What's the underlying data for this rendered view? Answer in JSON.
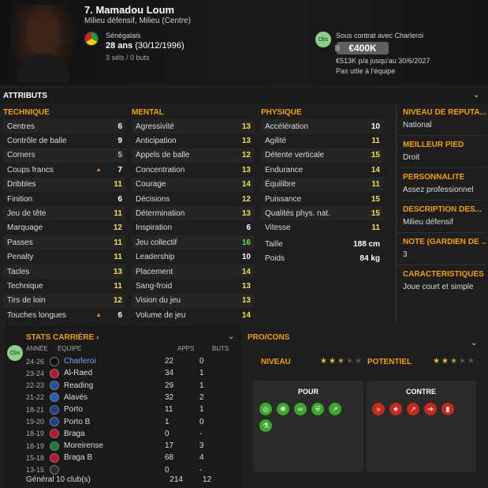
{
  "player": {
    "name": "7. Mamadou Loum",
    "role": "Milieu défensif, Milieu (Centre)",
    "nationality": "Sénégalais",
    "age": "28 ans",
    "dob": "(30/12/1996)",
    "caps": "3 séls / 0 buts",
    "obs_label": "Obs",
    "contract": "Sous contrat avec Charleroi",
    "value": "€400K",
    "wage": "€513K p/a jusqu'au 30/6/2027",
    "status": "Pas utile à l'équipe"
  },
  "attributes": {
    "title": "ATTRIBUTS",
    "technique_title": "TECHNIQUE",
    "mental_title": "MENTAL",
    "physique_title": "PHYSIQUE",
    "technique": [
      {
        "label": "Centres",
        "value": "6",
        "color": "#ffffff"
      },
      {
        "label": "Contrôle de balle",
        "value": "9",
        "color": "#ffffff"
      },
      {
        "label": "Corners",
        "value": "5",
        "color": "#bdbdbd"
      },
      {
        "label": "Coups francs",
        "value": "7",
        "color": "#ffffff",
        "arrow": true
      },
      {
        "label": "Dribbles",
        "value": "11",
        "color": "#f0e040"
      },
      {
        "label": "Finition",
        "value": "6",
        "color": "#ffffff"
      },
      {
        "label": "Jeu de tête",
        "value": "11",
        "color": "#f0e040"
      },
      {
        "label": "Marquage",
        "value": "12",
        "color": "#f0e040"
      },
      {
        "label": "Passes",
        "value": "11",
        "color": "#f0e040"
      },
      {
        "label": "Penalty",
        "value": "11",
        "color": "#f0e040"
      },
      {
        "label": "Tacles",
        "value": "13",
        "color": "#f0e040"
      },
      {
        "label": "Technique",
        "value": "11",
        "color": "#f0e040"
      },
      {
        "label": "Tirs de loin",
        "value": "12",
        "color": "#f0e040"
      },
      {
        "label": "Touches longues",
        "value": "6",
        "color": "#ffffff",
        "arrow": true
      }
    ],
    "mental": [
      {
        "label": "Agressivité",
        "value": "13",
        "color": "#f0e040"
      },
      {
        "label": "Anticipation",
        "value": "13",
        "color": "#f0e040"
      },
      {
        "label": "Appels de balle",
        "value": "12",
        "color": "#f0e040"
      },
      {
        "label": "Concentration",
        "value": "13",
        "color": "#f0e040"
      },
      {
        "label": "Courage",
        "value": "14",
        "color": "#f0e040"
      },
      {
        "label": "Décisions",
        "value": "12",
        "color": "#f0e040"
      },
      {
        "label": "Détermination",
        "value": "13",
        "color": "#f0e040"
      },
      {
        "label": "Inspiration",
        "value": "6",
        "color": "#ffffff"
      },
      {
        "label": "Jeu collectif",
        "value": "16",
        "color": "#6fdc4a"
      },
      {
        "label": "Leadership",
        "value": "10",
        "color": "#ffffff"
      },
      {
        "label": "Placement",
        "value": "14",
        "color": "#f0e040"
      },
      {
        "label": "Sang-froid",
        "value": "13",
        "color": "#f0e040"
      },
      {
        "label": "Vision du jeu",
        "value": "13",
        "color": "#f0e040"
      },
      {
        "label": "Volume de jeu",
        "value": "14",
        "color": "#f0e040"
      }
    ],
    "physique": [
      {
        "label": "Accélération",
        "value": "10",
        "color": "#ffffff"
      },
      {
        "label": "Agilité",
        "value": "11",
        "color": "#f0e040"
      },
      {
        "label": "Détente verticale",
        "value": "15",
        "color": "#f0e040"
      },
      {
        "label": "Endurance",
        "value": "14",
        "color": "#f0e040"
      },
      {
        "label": "Équilibre",
        "value": "11",
        "color": "#f0e040"
      },
      {
        "label": "Puissance",
        "value": "15",
        "color": "#f0e040"
      },
      {
        "label": "Qualités phys. nat.",
        "value": "15",
        "color": "#f0e040"
      },
      {
        "label": "Vitesse",
        "value": "11",
        "color": "#f0e040"
      }
    ],
    "height_label": "Taille",
    "height": "188 cm",
    "weight_label": "Poids",
    "weight": "84 kg"
  },
  "side": [
    {
      "title": "NIVEAU DE RÉPUTA...",
      "value": "National"
    },
    {
      "title": "MEILLEUR PIED",
      "value": "Droit"
    },
    {
      "title": "PERSONNALITÉ",
      "value": "Assez professionnel"
    },
    {
      "title": "DESCRIPTION DES...",
      "value": "Milieu défensif"
    },
    {
      "title": "NOTE (GARDIEN DE ...",
      "value": "3"
    },
    {
      "title": "CARACTÉRISTIQUES J",
      "value": "Joue court et simple"
    }
  ],
  "career": {
    "title": "STATS CARRIÈRE",
    "obs_label": "Obs",
    "headers": {
      "year": "ANNÉE",
      "team": "ÉQUIPE",
      "apps": "APPS",
      "goals": "BUTS"
    },
    "rows": [
      {
        "year": "24-26",
        "club": "Charleroi",
        "apps": "22",
        "goals": "0",
        "color": "#111111",
        "highlight": true
      },
      {
        "year": "23-24",
        "club": "Al-Raed",
        "apps": "34",
        "goals": "1",
        "color": "#c8102e"
      },
      {
        "year": "22-23",
        "club": "Reading",
        "apps": "29",
        "goals": "1",
        "color": "#1f4ea3"
      },
      {
        "year": "21-22",
        "club": "Alavés",
        "apps": "32",
        "goals": "2",
        "color": "#1d5fb8"
      },
      {
        "year": "18-21",
        "club": "Porto",
        "apps": "11",
        "goals": "1",
        "color": "#1b3f8f"
      },
      {
        "year": "19-20",
        "club": "Porto B",
        "apps": "1",
        "goals": "0",
        "color": "#1b3f8f"
      },
      {
        "year": "18-19",
        "club": "Braga",
        "apps": "0",
        "goals": "-",
        "color": "#c8102e"
      },
      {
        "year": "18-19",
        "club": "Moreirense",
        "apps": "17",
        "goals": "3",
        "color": "#1c7d2e"
      },
      {
        "year": "15-18",
        "club": "Braga B",
        "apps": "68",
        "goals": "4",
        "color": "#c8102e"
      },
      {
        "year": "13-15",
        "club": "",
        "apps": "0",
        "goals": "-",
        "color": "#2a2a2a"
      }
    ],
    "total": {
      "label": "Général",
      "clubs": "10 club(s)",
      "apps": "214",
      "goals": "12"
    }
  },
  "procons": {
    "title": "PRO/CONS",
    "level_label": "NIVEAU",
    "potential_label": "POTENTIEL",
    "level_stars": 2.5,
    "potential_stars": 2.5,
    "pros_title": "POUR",
    "cons_title": "CONTRE",
    "pros_icons": [
      "target-icon",
      "team-icon",
      "handshake-icon",
      "shield-icon",
      "boot-icon",
      "flask-icon"
    ],
    "cons_icons": [
      "running-icon",
      "star-icon",
      "trend-icon",
      "speed-icon",
      "card-icon"
    ],
    "pro_color": "#3aa82a",
    "con_color": "#c8281e"
  }
}
